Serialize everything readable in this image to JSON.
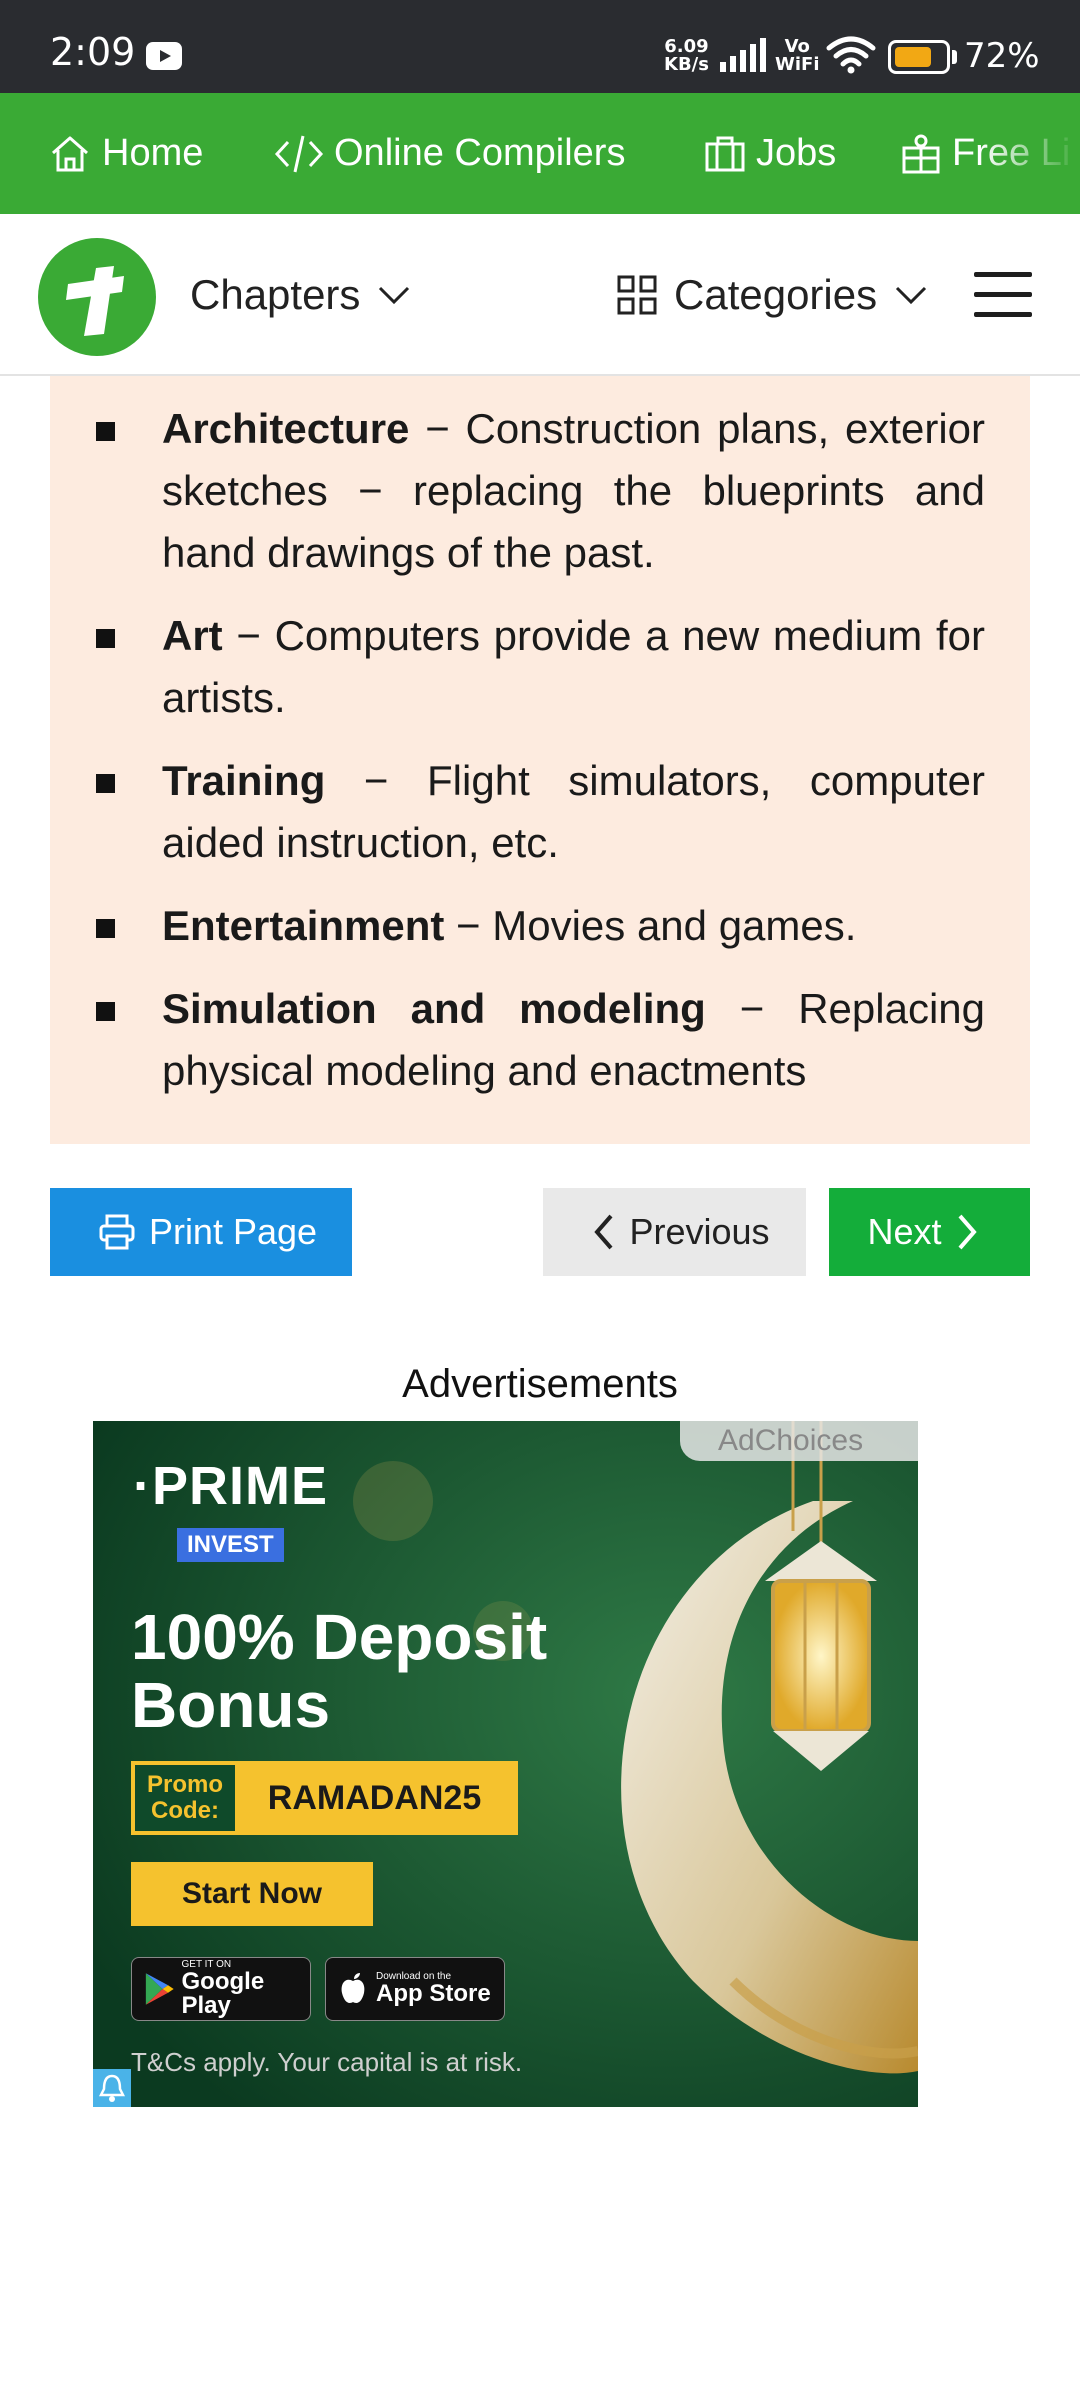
{
  "status_bar": {
    "time": "2:09",
    "speed_value": "6.09",
    "speed_unit": "KB/s",
    "vo": "Vo",
    "wifi_label": "WiFi",
    "battery_pct": "72%",
    "battery_level": 0.72,
    "battery_color": "#f2a814"
  },
  "topnav": {
    "color": "#3aaa35",
    "items": [
      {
        "label": "Home",
        "icon": "home-icon"
      },
      {
        "label": "Online Compilers",
        "icon": "code-icon"
      },
      {
        "label": "Jobs",
        "icon": "briefcase-icon"
      },
      {
        "label": "Free Li",
        "icon": "gift-icon"
      }
    ]
  },
  "header": {
    "chapters_label": "Chapters",
    "categories_label": "Categories"
  },
  "content": {
    "background": "#fdebdf",
    "items": [
      {
        "term": "Architecture",
        "desc": " − Construction plans, exterior sketches − replacing the blueprints and hand drawings of the past."
      },
      {
        "term": "Art",
        "desc": " − Computers provide a new medium for artists."
      },
      {
        "term": "Training",
        "desc": " − Flight simulators, computer aided instruction, etc."
      },
      {
        "term": "Entertainment",
        "desc": " − Movies and games."
      },
      {
        "term": "Simulation and modeling",
        "desc": " − Replacing physical modeling and enactments"
      }
    ]
  },
  "buttons": {
    "print": "Print Page",
    "previous": "Previous",
    "next": "Next",
    "print_color": "#1a8fe0",
    "next_color": "#14ad3a"
  },
  "ads": {
    "label": "Advertisements",
    "adchoices": "AdChoices",
    "brand": "·PRIME",
    "brand_sub": "INVEST",
    "headline": "100% Deposit Bonus",
    "promo_label": "Promo Code:",
    "promo_code": "RAMADAN25",
    "cta": "Start Now",
    "google_small": "GET IT ON",
    "google_big": "Google Play",
    "apple_small": "Download on the",
    "apple_big": "App Store",
    "terms": "T&Cs apply. Your capital is at risk."
  }
}
